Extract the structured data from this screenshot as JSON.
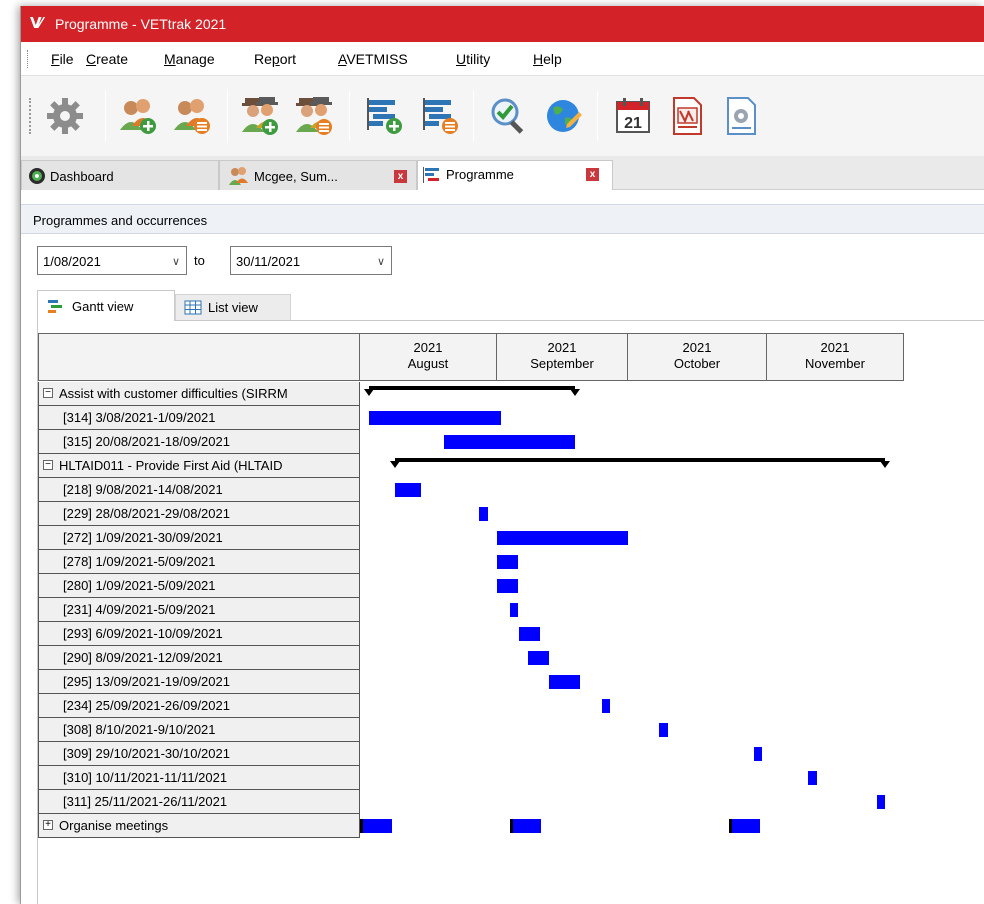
{
  "window": {
    "logo": "V⁄",
    "title": "Programme - VETtrak 2021",
    "titlebar_color": "#d32328"
  },
  "menu": [
    {
      "label": "File",
      "ul": "F",
      "rest": "ile"
    },
    {
      "label": "Create",
      "ul": "C",
      "rest": "reate"
    },
    {
      "label": "Manage",
      "ul": "M",
      "rest": "anage"
    },
    {
      "label": "Report",
      "pre": "Re",
      "ul": "p",
      "rest": "ort"
    },
    {
      "label": "AVETMISS",
      "ul": "A",
      "rest": "VETMISS"
    },
    {
      "label": "Utility",
      "ul": "U",
      "rest": "tility"
    },
    {
      "label": "Help",
      "ul": "H",
      "rest": "elp"
    }
  ],
  "toolbar": [
    "settings-icon",
    "add-client-icon",
    "edit-client-icon",
    "add-contact-icon",
    "edit-contact-icon",
    "add-programme-icon",
    "edit-programme-icon",
    "search-icon",
    "web-icon",
    "calendar-icon",
    "vettrak-doc-icon",
    "report-doc-icon"
  ],
  "calendar_day": "21",
  "tabs": [
    {
      "label": "Dashboard",
      "closable": false
    },
    {
      "label": "Mcgee, Sum...",
      "closable": true
    },
    {
      "label": "Programme",
      "closable": true,
      "active": true
    }
  ],
  "section_title": "Programmes and occurrences",
  "date_from": "1/08/2021",
  "date_to_label": "to",
  "date_to": "30/11/2021",
  "view_tabs": {
    "gantt": "Gantt view",
    "list": "List view"
  },
  "months": [
    {
      "year": "2021",
      "name": "August"
    },
    {
      "year": "2021",
      "name": "September"
    },
    {
      "year": "2021",
      "name": "October"
    },
    {
      "year": "2021",
      "name": "November"
    }
  ],
  "rows": [
    {
      "type": "group",
      "label": "Assist with customer difficulties (SIRRM",
      "expanded": true,
      "summary": [
        "3/08/2021",
        "18/09/2021"
      ]
    },
    {
      "type": "child",
      "label": "[314]  3/08/2021-1/09/2021",
      "start": "3/08/2021",
      "end": "1/09/2021"
    },
    {
      "type": "child",
      "label": "[315]  20/08/2021-18/09/2021",
      "start": "20/08/2021",
      "end": "18/09/2021"
    },
    {
      "type": "group",
      "label": "HLTAID011 - Provide First Aid (HLTAID",
      "expanded": true,
      "summary": [
        "9/08/2021",
        "26/11/2021"
      ]
    },
    {
      "type": "child",
      "label": "[218]  9/08/2021-14/08/2021",
      "start": "9/08/2021",
      "end": "14/08/2021"
    },
    {
      "type": "child",
      "label": "[229]  28/08/2021-29/08/2021",
      "start": "28/08/2021",
      "end": "29/08/2021"
    },
    {
      "type": "child",
      "label": "[272]  1/09/2021-30/09/2021",
      "start": "1/09/2021",
      "end": "30/09/2021"
    },
    {
      "type": "child",
      "label": "[278]  1/09/2021-5/09/2021",
      "start": "1/09/2021",
      "end": "5/09/2021"
    },
    {
      "type": "child",
      "label": "[280]  1/09/2021-5/09/2021",
      "start": "1/09/2021",
      "end": "5/09/2021"
    },
    {
      "type": "child",
      "label": "[231]  4/09/2021-5/09/2021",
      "start": "4/09/2021",
      "end": "5/09/2021"
    },
    {
      "type": "child",
      "label": "[293]  6/09/2021-10/09/2021",
      "start": "6/09/2021",
      "end": "10/09/2021"
    },
    {
      "type": "child",
      "label": "[290]  8/09/2021-12/09/2021",
      "start": "8/09/2021",
      "end": "12/09/2021"
    },
    {
      "type": "child",
      "label": "[295]  13/09/2021-19/09/2021",
      "start": "13/09/2021",
      "end": "19/09/2021"
    },
    {
      "type": "child",
      "label": "[234]  25/09/2021-26/09/2021",
      "start": "25/09/2021",
      "end": "26/09/2021"
    },
    {
      "type": "child",
      "label": "[308]  8/10/2021-9/10/2021",
      "start": "8/10/2021",
      "end": "9/10/2021"
    },
    {
      "type": "child",
      "label": "[309]  29/10/2021-30/10/2021",
      "start": "29/10/2021",
      "end": "30/10/2021"
    },
    {
      "type": "child",
      "label": "[310]  10/11/2021-11/11/2021",
      "start": "10/11/2021",
      "end": "11/11/2021"
    },
    {
      "type": "child",
      "label": "[311]  25/11/2021-26/11/2021",
      "start": "25/11/2021",
      "end": "26/11/2021"
    },
    {
      "type": "group",
      "label": "Organise meetings",
      "expanded": false
    }
  ],
  "bar_color": "#0000ff"
}
